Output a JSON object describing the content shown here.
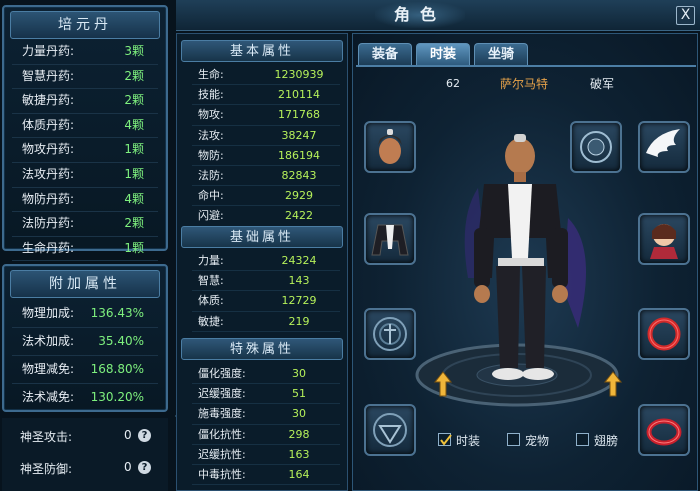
{
  "window": {
    "title": "角色",
    "close_label": "X"
  },
  "peiyuan": {
    "title": "培元丹",
    "items": [
      {
        "label": "力量丹药:",
        "value": "3颗"
      },
      {
        "label": "智慧丹药:",
        "value": "2颗"
      },
      {
        "label": "敏捷丹药:",
        "value": "2颗"
      },
      {
        "label": "体质丹药:",
        "value": "4颗"
      },
      {
        "label": "物攻丹药:",
        "value": "1颗"
      },
      {
        "label": "法攻丹药:",
        "value": "1颗"
      },
      {
        "label": "物防丹药:",
        "value": "4颗"
      },
      {
        "label": "法防丹药:",
        "value": "2颗"
      },
      {
        "label": "生命丹药:",
        "value": "1颗"
      }
    ]
  },
  "fujia": {
    "title": "附加属性",
    "items": [
      {
        "label": "物理加成:",
        "value": "136.43%"
      },
      {
        "label": "法术加成:",
        "value": "35.40%"
      },
      {
        "label": "物理减免:",
        "value": "168.80%"
      },
      {
        "label": "法术减免:",
        "value": "130.20%"
      }
    ]
  },
  "shengsheng": {
    "items": [
      {
        "label": "神圣攻击:",
        "value": "0",
        "help": "?"
      },
      {
        "label": "神圣防御:",
        "value": "0",
        "help": "?"
      }
    ]
  },
  "collapse_arrow": "«",
  "basic": {
    "title": "基本属性",
    "items": [
      {
        "label": "生命:",
        "value": "1230939"
      },
      {
        "label": "技能:",
        "value": "210114"
      },
      {
        "label": "物攻:",
        "value": "171768"
      },
      {
        "label": "法攻:",
        "value": "38247"
      },
      {
        "label": "物防:",
        "value": "186194"
      },
      {
        "label": "法防:",
        "value": "82843"
      },
      {
        "label": "命中:",
        "value": "2929"
      },
      {
        "label": "闪避:",
        "value": "2422"
      }
    ]
  },
  "base": {
    "title": "基础属性",
    "items": [
      {
        "label": "力量:",
        "value": "24324"
      },
      {
        "label": "智慧:",
        "value": "143"
      },
      {
        "label": "体质:",
        "value": "12729"
      },
      {
        "label": "敏捷:",
        "value": "219"
      }
    ]
  },
  "special": {
    "title": "特殊属性",
    "items": [
      {
        "label": "僵化强度:",
        "value": "30"
      },
      {
        "label": "迟缓强度:",
        "value": "51"
      },
      {
        "label": "施毒强度:",
        "value": "30"
      },
      {
        "label": "僵化抗性:",
        "value": "298"
      },
      {
        "label": "迟缓抗性:",
        "value": "163"
      },
      {
        "label": "中毒抗性:",
        "value": "164"
      }
    ]
  },
  "tabs": [
    {
      "label": "装备",
      "active": false
    },
    {
      "label": "时装",
      "active": true
    },
    {
      "label": "坐骑",
      "active": false
    }
  ],
  "character": {
    "level": "62",
    "name": "萨尔马特",
    "title": "破军"
  },
  "checkboxes": [
    {
      "label": "时装",
      "checked": true
    },
    {
      "label": "宠物",
      "checked": false
    },
    {
      "label": "翅膀",
      "checked": false
    }
  ],
  "colors": {
    "value_green": "#7ef07e",
    "stat_green": "#b5f05a",
    "name_orange": "#e7a34a",
    "accent_blue": "#3d6a8e"
  },
  "icons": {
    "left_slots": [
      "hair-icon",
      "coat-icon",
      "emblem-icon",
      "rune-icon"
    ],
    "right_slots": [
      "orb-icon",
      "wings-icon",
      "pet-icon",
      "ring-icon",
      "bracelet-icon"
    ],
    "rotate": [
      "rotate-left-icon",
      "rotate-right-icon"
    ]
  }
}
